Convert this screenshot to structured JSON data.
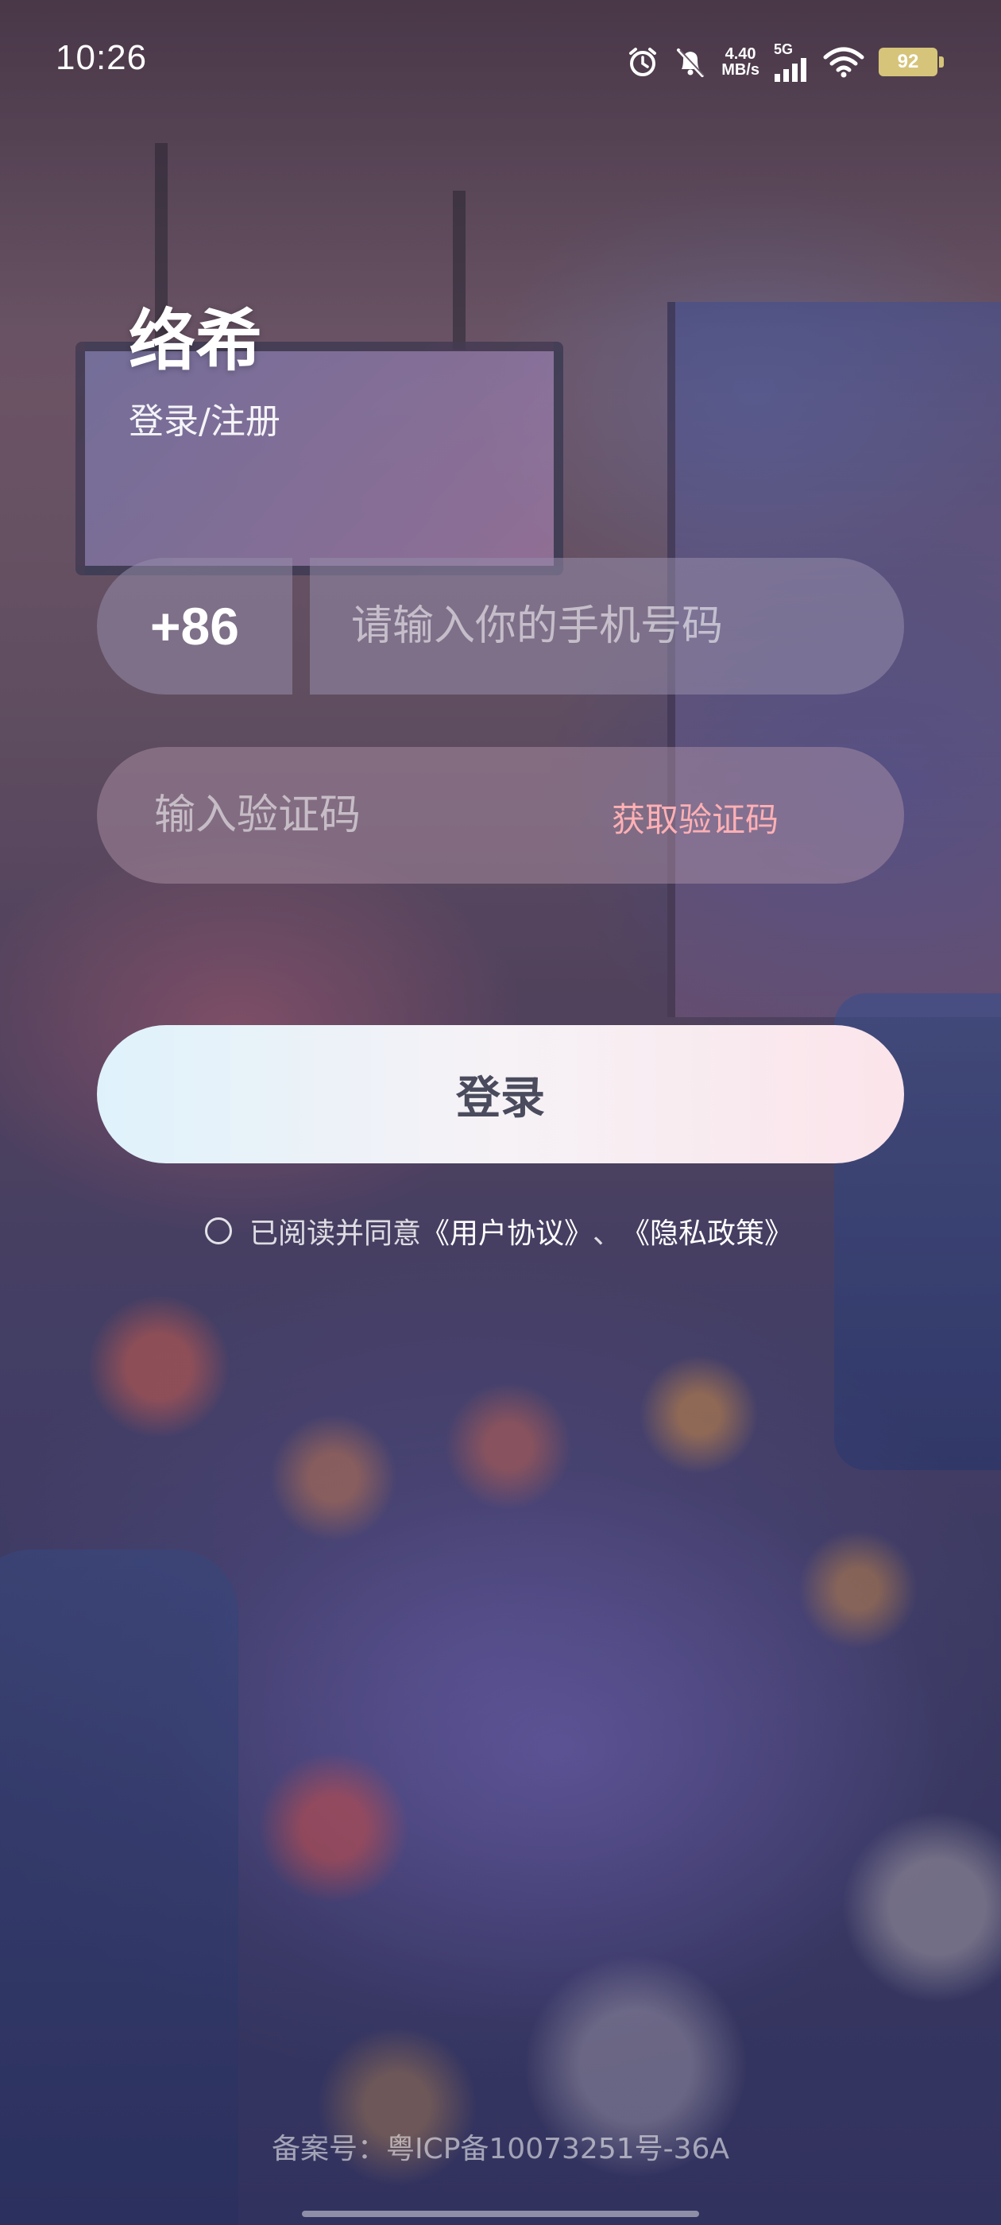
{
  "status_bar": {
    "time": "10:26",
    "net_speed_value": "4.40",
    "net_speed_unit": "MB/s",
    "network_type": "5G",
    "battery": "92",
    "icons": [
      "alarm-icon",
      "mute-icon",
      "signal-icon",
      "wifi-icon",
      "battery-icon"
    ]
  },
  "header": {
    "title": "络希",
    "subtitle": "登录/注册"
  },
  "form": {
    "country_code": "+86",
    "phone_placeholder": "请输入你的手机号码",
    "code_placeholder": "输入验证码",
    "get_code_label": "获取验证码",
    "login_label": "登录"
  },
  "agreement": {
    "prefix": "已阅读并同意",
    "user_agreement": "《用户协议》",
    "separator": "、",
    "privacy_policy": "《隐私政策》"
  },
  "footer": {
    "icp": "备案号：粤ICP备10073251号-36A"
  },
  "colors": {
    "accent_pink": "#ffb0b4",
    "login_text": "#4b4b5e"
  }
}
